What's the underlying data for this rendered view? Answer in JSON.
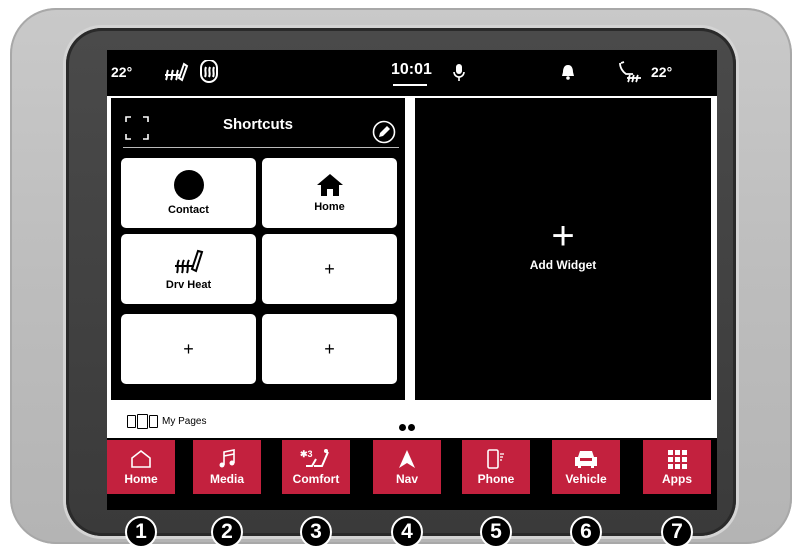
{
  "status": {
    "temp_left": "22°",
    "temp_right": "22°",
    "clock": "10:01",
    "icons": [
      "heated-steering-icon",
      "defrost-icon",
      "microphone-icon",
      "bell-icon",
      "driver-seat-heat-icon"
    ]
  },
  "shortcuts": {
    "title": "Shortcuts",
    "tiles": [
      {
        "label": "Contact",
        "icon": "contact-icon"
      },
      {
        "label": "Home",
        "icon": "home-icon"
      },
      {
        "label": "Drv Heat",
        "icon": "seat-heat-icon"
      },
      {
        "label": "+",
        "icon": ""
      },
      {
        "label": "+",
        "icon": ""
      },
      {
        "label": "+",
        "icon": ""
      }
    ]
  },
  "widget": {
    "plus": "+",
    "label": "Add Widget"
  },
  "pages": {
    "label": "My Pages"
  },
  "nav": [
    {
      "label": "Home",
      "icon": "home-outline-icon"
    },
    {
      "label": "Media",
      "icon": "music-note-icon"
    },
    {
      "label": "Comfort",
      "icon": "comfort-seat-icon"
    },
    {
      "label": "Nav",
      "icon": "navigation-arrow-icon"
    },
    {
      "label": "Phone",
      "icon": "phone-icon"
    },
    {
      "label": "Vehicle",
      "icon": "car-icon"
    },
    {
      "label": "Apps",
      "icon": "apps-grid-icon"
    }
  ],
  "callouts": [
    "1",
    "2",
    "3",
    "4",
    "5",
    "6",
    "7"
  ],
  "colors": {
    "accent": "#c3213e",
    "screen": "#000000",
    "tile": "#ffffff"
  }
}
